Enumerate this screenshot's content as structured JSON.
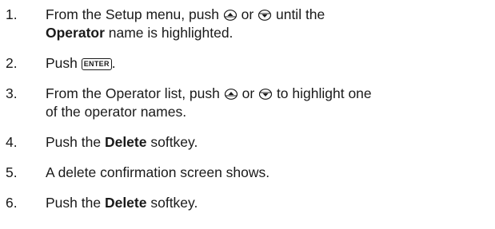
{
  "steps": [
    {
      "number": "1.",
      "line1_a": "From the Setup menu, push",
      "icon_up": "up-arrow-key-icon",
      "or": "or",
      "icon_down": "down-arrow-key-icon",
      "line1_b": "until the",
      "line2_bold": "Operator",
      "line2_rest": " name is highlighted."
    },
    {
      "number": "2.",
      "prefix": "Push ",
      "key": "ENTER",
      "suffix": "."
    },
    {
      "number": "3.",
      "line1_a": "From the Operator list, push",
      "icon_up": "up-arrow-key-icon",
      "or": "or",
      "icon_down": "down-arrow-key-icon",
      "line1_b": "to highlight one",
      "line2": "of the operator names."
    },
    {
      "number": "4.",
      "prefix": "Push the ",
      "bold": "Delete",
      "suffix": " softkey."
    },
    {
      "number": "5.",
      "text": "A delete confirmation screen shows."
    },
    {
      "number": "6.",
      "prefix": "Push the ",
      "bold": "Delete",
      "suffix": " softkey."
    }
  ]
}
